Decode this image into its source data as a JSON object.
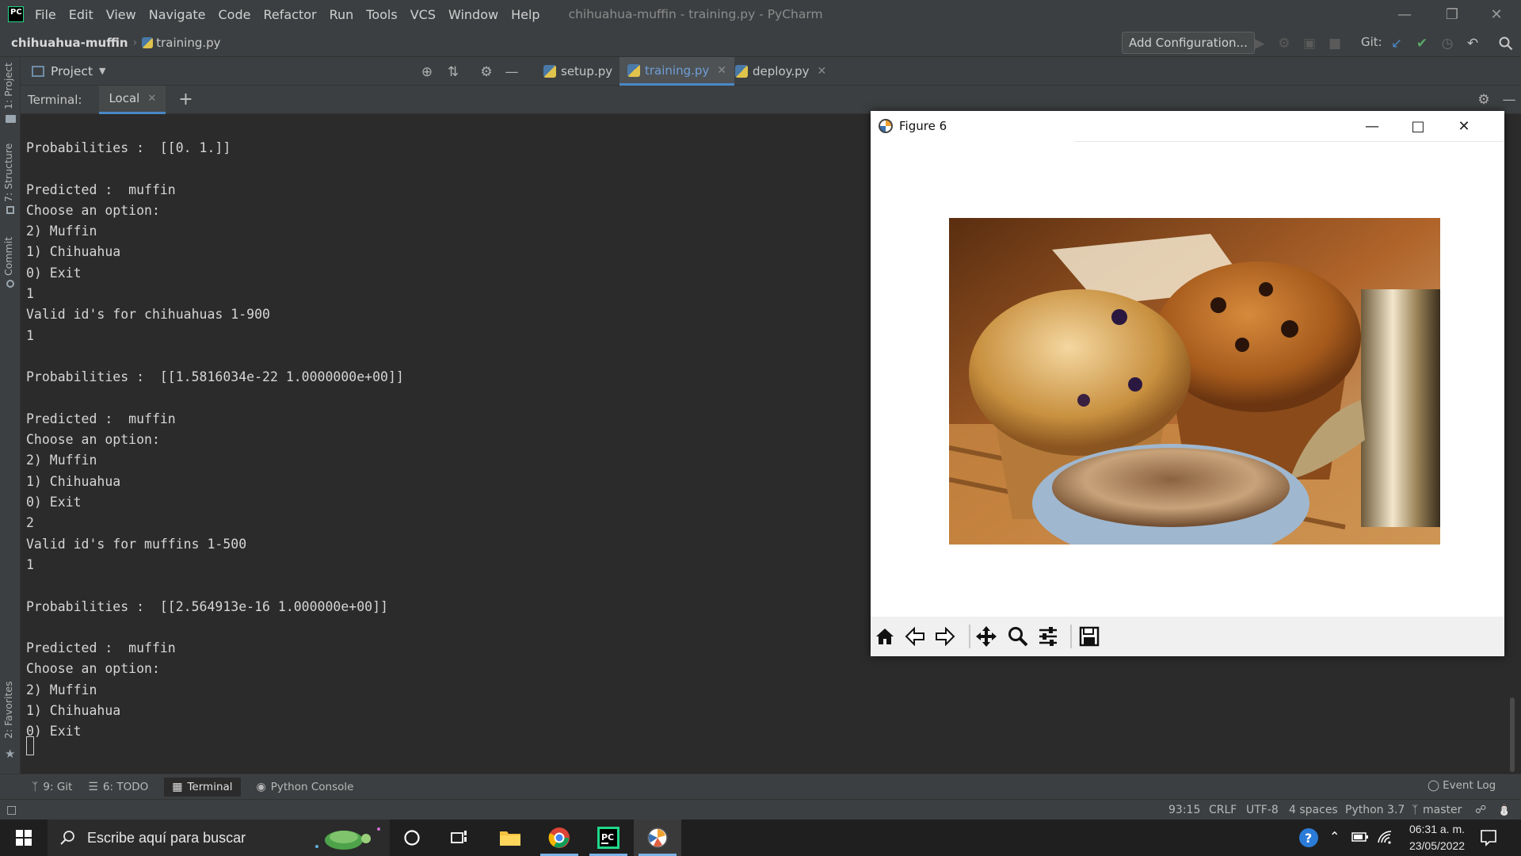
{
  "window": {
    "title": "chihuahua-muffin - training.py - PyCharm",
    "menu": [
      "File",
      "Edit",
      "View",
      "Navigate",
      "Code",
      "Refactor",
      "Run",
      "Tools",
      "VCS",
      "Window",
      "Help"
    ]
  },
  "navbar": {
    "project": "chihuahua-muffin",
    "file": "training.py",
    "add_configuration": "Add Configuration...",
    "git_label": "Git:"
  },
  "left_strip": {
    "project": "1: Project",
    "structure": "7: Structure",
    "commit": "Commit",
    "favorites": "2: Favorites"
  },
  "project_panel": {
    "label": "Project"
  },
  "editor_tabs": [
    {
      "label": "setup.py"
    },
    {
      "label": "training.py"
    },
    {
      "label": "deploy.py"
    }
  ],
  "terminal": {
    "title": "Terminal:",
    "tab": "Local",
    "lines": [
      "Probabilities :  [[0. 1.]]",
      "",
      "Predicted :  muffin",
      "Choose an option:",
      "2) Muffin",
      "1) Chihuahua",
      "0) Exit",
      "1",
      "Valid id's for chihuahuas 1-900",
      "1",
      "",
      "Probabilities :  [[1.5816034e-22 1.0000000e+00]]",
      "",
      "Predicted :  muffin",
      "Choose an option:",
      "2) Muffin",
      "1) Chihuahua",
      "0) Exit",
      "2",
      "Valid id's for muffins 1-500",
      "1",
      "",
      "Probabilities :  [[2.564913e-16 1.000000e+00]]",
      "",
      "Predicted :  muffin",
      "Choose an option:",
      "2) Muffin",
      "1) Chihuahua",
      "0) Exit"
    ]
  },
  "figure": {
    "title": "Figure 6",
    "toolbar": [
      "home-icon",
      "back-arrow-icon",
      "forward-arrow-icon",
      "pan-icon",
      "zoom-icon",
      "configure-subplots-icon",
      "save-icon"
    ]
  },
  "bottom_tabs": {
    "git": "9: Git",
    "todo": "6: TODO",
    "terminal": "Terminal",
    "python_console": "Python Console",
    "event_log": "Event Log"
  },
  "statusbar": {
    "position": "93:15",
    "line_sep": "CRLF",
    "encoding": "UTF-8",
    "indent": "4 spaces",
    "interpreter": "Python 3.7",
    "branch": "master"
  },
  "taskbar": {
    "search_placeholder": "Escribe aquí para buscar",
    "time": "06:31 a. m.",
    "date": "23/05/2022"
  },
  "colors": {
    "ide_background": "#2b2b2b",
    "panel": "#3c3f41",
    "accent": "#4a88c7",
    "taskbar": "#1f1f1f"
  }
}
